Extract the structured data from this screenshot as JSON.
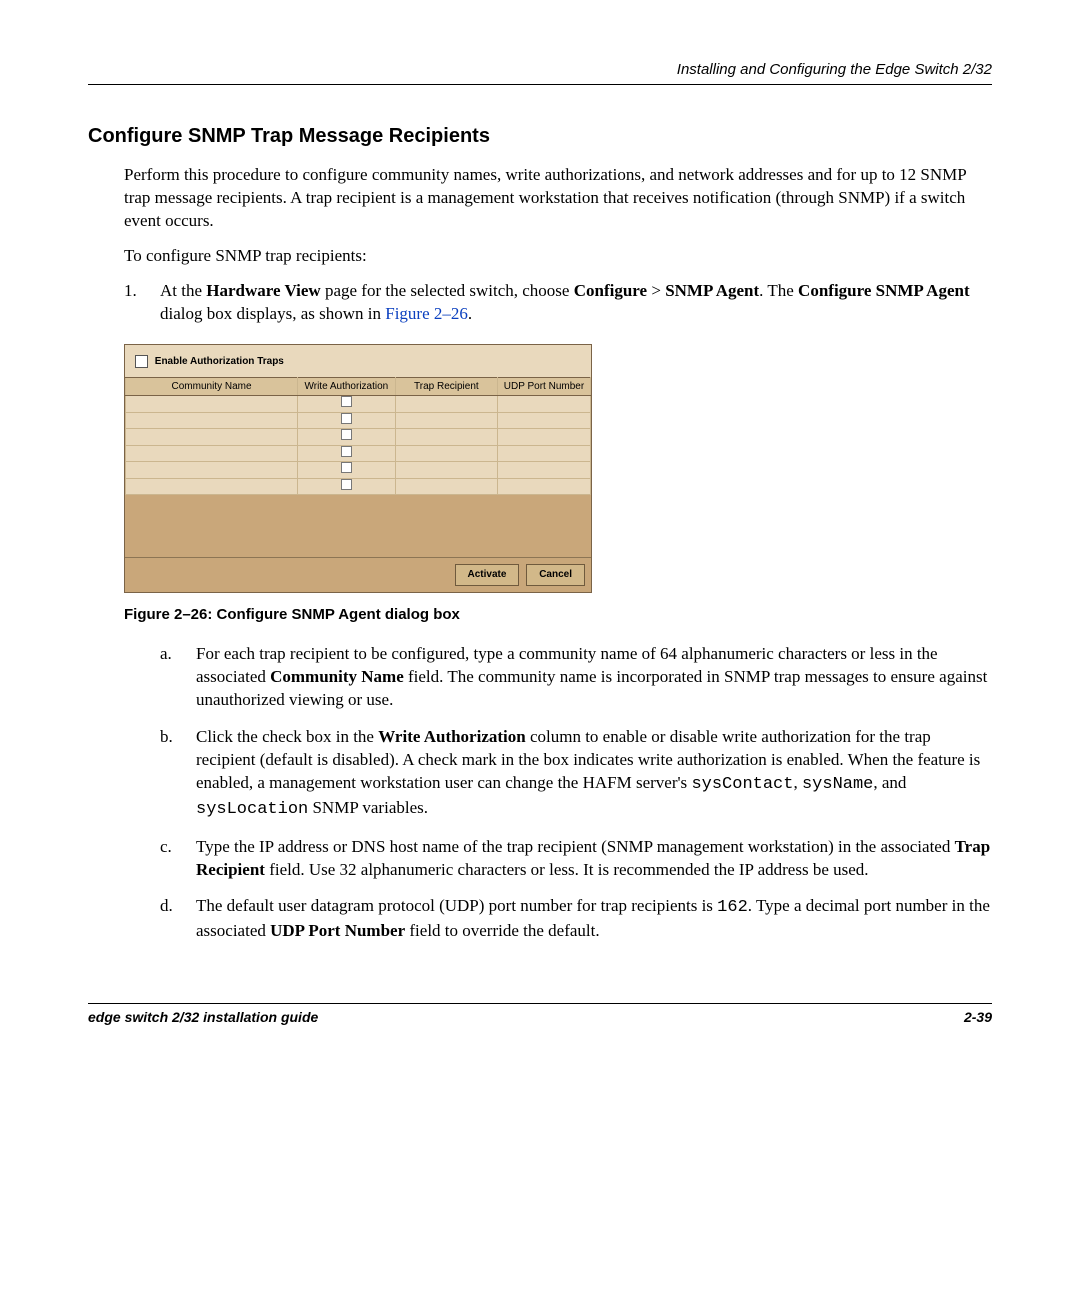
{
  "header": {
    "running": "Installing and Configuring the Edge Switch 2/32"
  },
  "section": {
    "title": "Configure SNMP Trap Message Recipients"
  },
  "intro": {
    "p1": "Perform this procedure to configure community names, write authorizations, and network addresses and for up to 12 SNMP trap message recipients. A trap recipient is a management workstation that receives notification (through SNMP) if a switch event occurs.",
    "p2": "To configure SNMP trap recipients:"
  },
  "step1": {
    "marker": "1.",
    "pre": "At the ",
    "hw": "Hardware View",
    "mid1": " page for the selected switch, choose ",
    "conf": "Configure",
    "gt": " > ",
    "snmp": "SNMP Agent",
    "mid2": ". The ",
    "csa": "Configure SNMP Agent",
    "mid3": " dialog box displays, as shown in ",
    "figlink": "Figure 2–26",
    "end": "."
  },
  "dialog": {
    "enable_label": "Enable Authorization Traps",
    "cols": {
      "c1": "Community Name",
      "c2": "Write Authorization",
      "c3": "Trap Recipient",
      "c4": "UDP Port Number"
    },
    "activate": "Activate",
    "cancel": "Cancel"
  },
  "fig_caption": "Figure 2–26:  Configure SNMP Agent dialog box",
  "steps_alpha": {
    "a": {
      "marker": "a.",
      "t1": "For each trap recipient to be configured, type a community name of 64 alphanumeric characters or less in the associated ",
      "b1": "Community Name",
      "t2": " field. The community name is incorporated in SNMP trap messages to ensure against unauthorized viewing or use."
    },
    "b": {
      "marker": "b.",
      "t1": "Click the check box in the ",
      "b1": "Write Authorization",
      "t2": " column to enable or disable write authorization for the trap recipient (default is disabled). A check mark in the box indicates write authorization is enabled. When the feature is enabled, a management workstation user can change the HAFM server's ",
      "m1": "sysContact",
      "c1": ", ",
      "m2": "sysName",
      "c2": ", and ",
      "m3": "sysLocation",
      "t3": " SNMP variables."
    },
    "c": {
      "marker": "c.",
      "t1": "Type the IP address or DNS host name of the trap recipient (SNMP management workstation) in the associated ",
      "b1": "Trap Recipient",
      "t2": " field. Use 32 alphanumeric characters or less. It is recommended the IP address be used."
    },
    "d": {
      "marker": "d.",
      "t1": "The default user datagram protocol (UDP) port number for trap recipients is ",
      "m1": "162",
      "t2": ". Type a decimal port number in the associated ",
      "b1": "UDP Port Number",
      "t3": " field to override the default."
    }
  },
  "footer": {
    "left": "edge switch 2/32 installation guide",
    "right": "2-39"
  }
}
